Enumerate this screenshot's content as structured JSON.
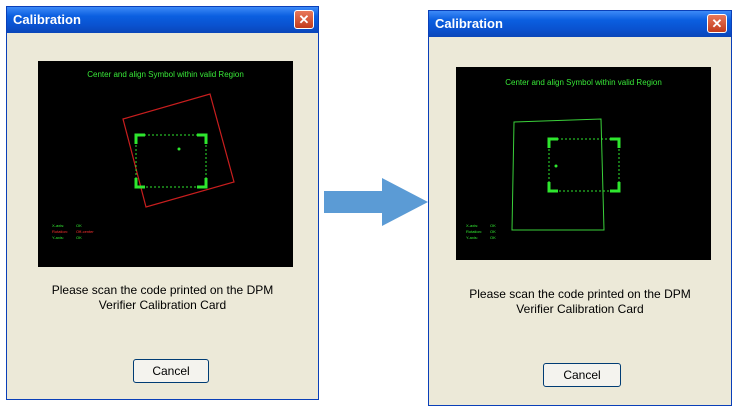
{
  "dialog_before": {
    "title": "Calibration",
    "close_label": "✕",
    "screen_message": "Center and align Symbol within valid Region",
    "status": [
      {
        "label": "X-axis:",
        "value": "OK",
        "color": "#33ee33"
      },
      {
        "label": "Rotation:",
        "value": "Off-center",
        "color": "#ff3030"
      },
      {
        "label": "Y-axis:",
        "value": "OK",
        "color": "#33ee33"
      }
    ],
    "instructions": [
      "Please scan the code printed on the DPM",
      "Verifier Calibration Card"
    ],
    "cancel_label": "Cancel"
  },
  "dialog_after": {
    "title": "Calibration",
    "close_label": "✕",
    "screen_message": "Center and align Symbol within valid Region",
    "status": [
      {
        "label": "X-axis:",
        "value": "OK",
        "color": "#33ee33"
      },
      {
        "label": "Rotation:",
        "value": "OK",
        "color": "#33ee33"
      },
      {
        "label": "Y-axis:",
        "value": "OK",
        "color": "#33ee33"
      }
    ],
    "instructions": [
      "Please scan the code printed on the DPM",
      "Verifier Calibration Card"
    ],
    "cancel_label": "Cancel"
  },
  "colors": {
    "target_box": "#2ee62e",
    "misaligned_symbol": "#c81e1e",
    "aligned_symbol": "#3ad03a",
    "arrow": "#5b9bd5"
  },
  "transition_icon": "right-arrow-icon"
}
